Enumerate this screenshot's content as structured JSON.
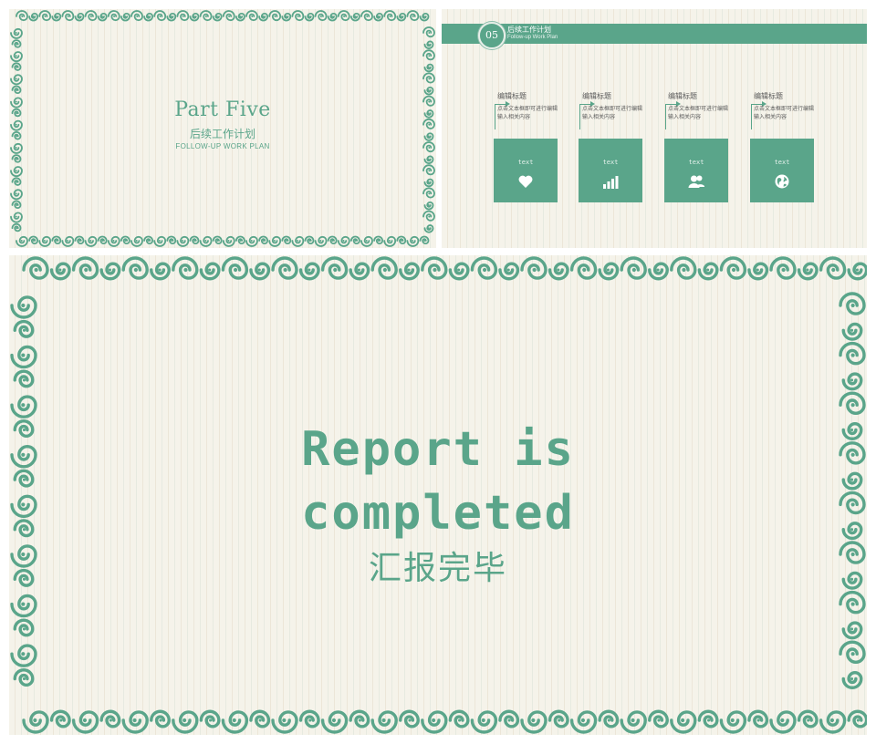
{
  "colors": {
    "accent": "#5aa58a",
    "background": "#f5f3ea",
    "text_dark": "#5b5b5b"
  },
  "slide_a": {
    "title": "Part Five",
    "subtitle": "后续工作计划",
    "subtitle_en": "FOLLOW-UP WORK PLAN"
  },
  "slide_b": {
    "badge": "05",
    "header_title": "后续工作计划",
    "header_subtitle": "Follow-up Work Plan",
    "cards": [
      {
        "title": "编辑标题",
        "body": "点击文本框即可进行编辑输入相关内容",
        "box_label": "text",
        "icon": "heart-icon"
      },
      {
        "title": "编辑标题",
        "body": "点击文本框即可进行编辑输入相关内容",
        "box_label": "text",
        "icon": "bar-chart-icon"
      },
      {
        "title": "编辑标题",
        "body": "点击文本框即可进行编辑输入相关内容",
        "box_label": "text",
        "icon": "users-icon"
      },
      {
        "title": "编辑标题",
        "body": "点击文本框即可进行编辑输入相关内容",
        "box_label": "text",
        "icon": "globe-icon"
      }
    ]
  },
  "slide_c": {
    "title_line1": "Report is",
    "title_line2": "completed",
    "subtitle": "汇报完毕"
  }
}
